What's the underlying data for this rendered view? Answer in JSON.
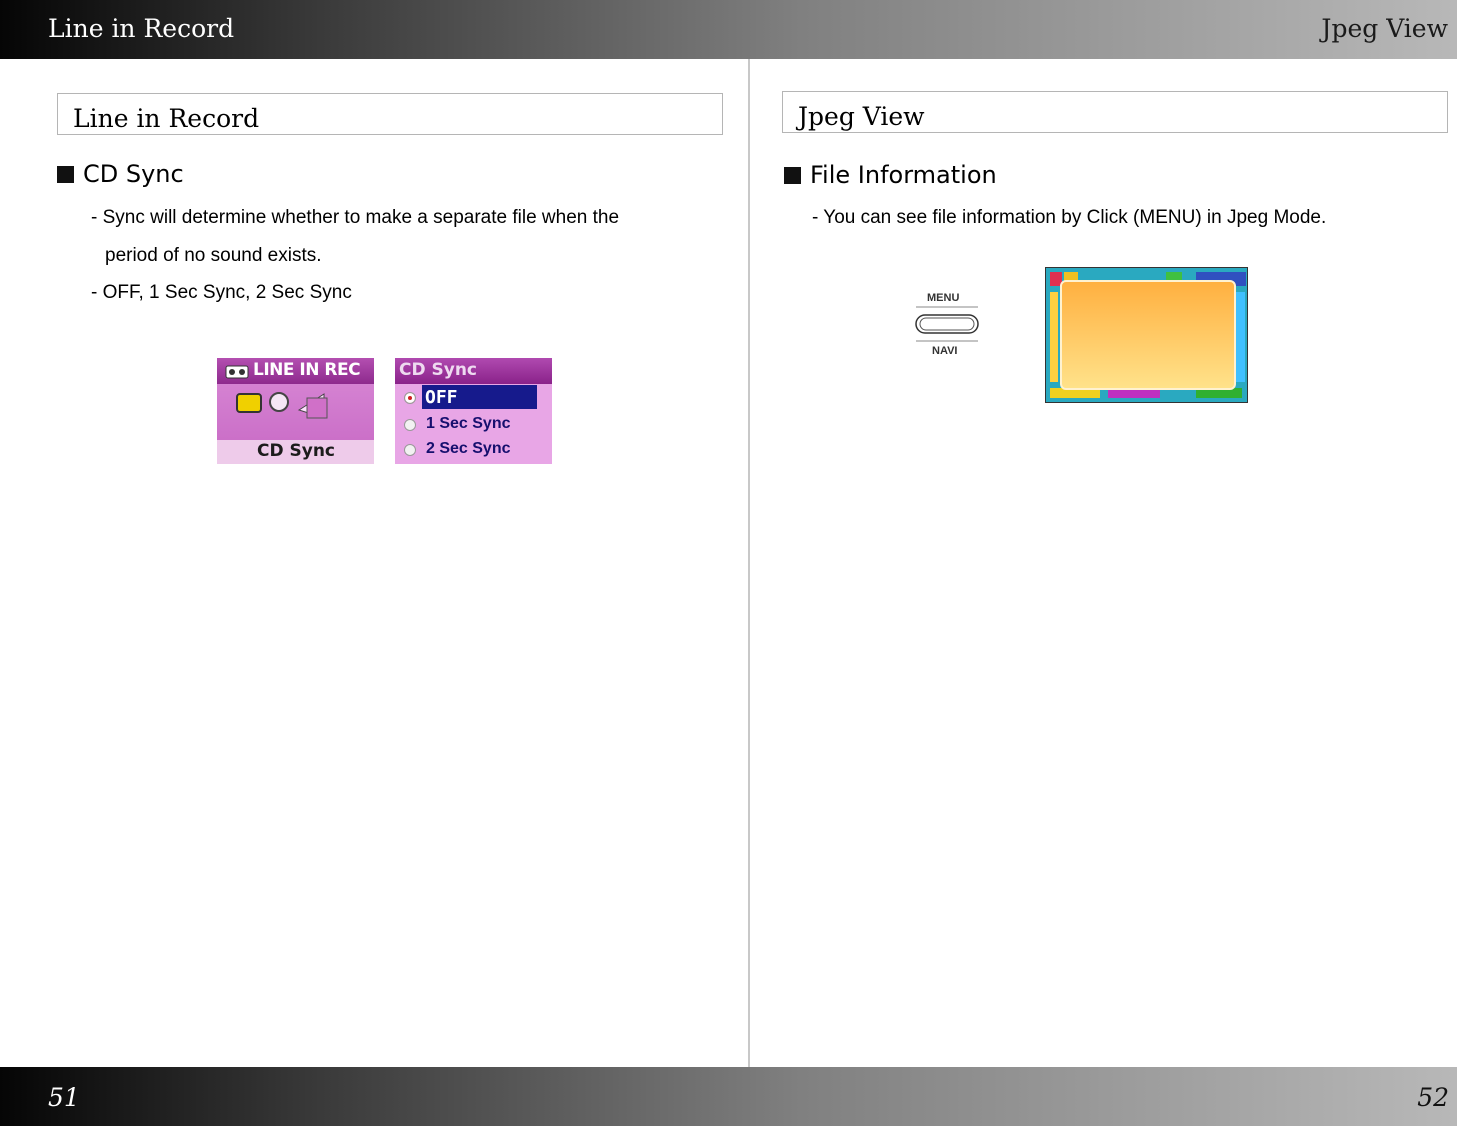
{
  "header": {
    "left_title": "Line in Record",
    "right_title": "Jpeg View"
  },
  "footer": {
    "left_page": "51",
    "right_page": "52"
  },
  "left_page": {
    "section_title": "Line in Record",
    "heading": "CD Sync",
    "lines": [
      "- Sync will determine whether to make a separate file when the",
      "period of no sound exists.",
      "- OFF, 1 Sec Sync, 2 Sec Sync"
    ],
    "screen1": {
      "title": "LINE IN REC",
      "label": "CD Sync"
    },
    "screen2": {
      "title": "CD Sync",
      "options": [
        "OFF",
        "1 Sec Sync",
        "2 Sec Sync"
      ]
    }
  },
  "right_page": {
    "section_title": "Jpeg View",
    "heading": "File Information",
    "lines": [
      "- You can see file information by Click (MENU) in Jpeg Mode."
    ],
    "button": {
      "top_label": "MENU",
      "bottom_label": "NAVI"
    }
  },
  "colors": {
    "screen_pink": "#c768c4",
    "screen_header": "#8d2a8d",
    "selection_blue": "#161a8c",
    "popup_orange": "#ffb040"
  },
  "icons": [
    "cassette-icon",
    "menu-navi-button-icon"
  ]
}
